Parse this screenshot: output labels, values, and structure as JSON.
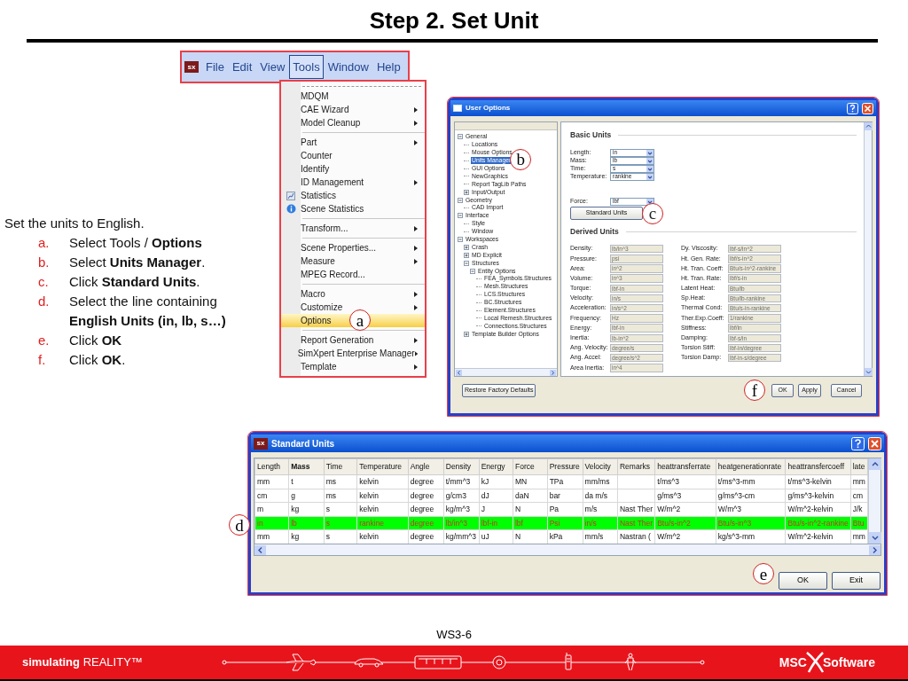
{
  "title": "Step 2. Set Unit",
  "instructions": {
    "intro": "Set the units to English.",
    "steps": [
      {
        "marker": "a.",
        "text": "Select Tools / **Options**"
      },
      {
        "marker": "b.",
        "text": "Select **Units Manager**."
      },
      {
        "marker": "c.",
        "text": "Click **Standard Units**."
      },
      {
        "marker": "d.",
        "text": "Select the line containing **English Units (in, lb, s…)**"
      },
      {
        "marker": "e.",
        "text": "Click **OK**"
      },
      {
        "marker": "f.",
        "text": "Click **OK**."
      }
    ]
  },
  "menu_bar": {
    "logo": "sx",
    "items": [
      {
        "label": "File",
        "selected": false
      },
      {
        "label": "Edit",
        "selected": false
      },
      {
        "label": "View",
        "selected": false
      },
      {
        "label": "Tools",
        "selected": true
      },
      {
        "label": "Window",
        "selected": false
      },
      {
        "label": "Help",
        "selected": false
      }
    ]
  },
  "tools_menu": {
    "groups": [
      {
        "items": [
          {
            "label": "MDQM",
            "kind": "plain",
            "submenu": false,
            "selected": false
          },
          {
            "label": "CAE Wizard",
            "kind": "plain",
            "submenu": true,
            "selected": false
          },
          {
            "label": "Model Cleanup",
            "kind": "plain",
            "submenu": true,
            "selected": false
          }
        ]
      },
      {
        "items": [
          {
            "label": "Part",
            "kind": "plain",
            "submenu": true,
            "selected": false
          },
          {
            "label": "Counter",
            "kind": "plain",
            "submenu": false,
            "selected": false
          },
          {
            "label": "Identify",
            "kind": "plain",
            "submenu": false,
            "selected": false
          },
          {
            "label": "ID Management",
            "kind": "plain",
            "submenu": true,
            "selected": false
          },
          {
            "label": "Statistics",
            "kind": "chart",
            "submenu": false,
            "selected": false
          },
          {
            "label": "Scene Statistics",
            "kind": "info",
            "submenu": false,
            "selected": false
          }
        ]
      },
      {
        "items": [
          {
            "label": "Transform...",
            "kind": "plain",
            "submenu": true,
            "selected": false
          }
        ]
      },
      {
        "items": [
          {
            "label": "Scene Properties...",
            "kind": "plain",
            "submenu": true,
            "selected": false
          },
          {
            "label": "Measure",
            "kind": "plain",
            "submenu": true,
            "selected": false
          },
          {
            "label": "MPEG Record...",
            "kind": "plain",
            "submenu": false,
            "selected": false
          }
        ]
      },
      {
        "items": [
          {
            "label": "Macro",
            "kind": "plain",
            "submenu": true,
            "selected": false
          },
          {
            "label": "Customize",
            "kind": "plain",
            "submenu": true,
            "selected": false
          },
          {
            "label": "Options",
            "kind": "plain",
            "submenu": false,
            "selected": true,
            "callout": "a"
          }
        ]
      },
      {
        "items": [
          {
            "label": "Report Generation",
            "kind": "plain",
            "submenu": true,
            "selected": false
          },
          {
            "label": "SimXpert Enterprise Manager",
            "kind": "plain",
            "submenu": true,
            "selected": false
          },
          {
            "label": "Template",
            "kind": "plain",
            "submenu": true,
            "selected": false
          }
        ]
      }
    ]
  },
  "user_options": {
    "title": "User Options",
    "tree": [
      {
        "label": "General",
        "expanded": true,
        "selected": false,
        "children": [
          {
            "label": "Locations",
            "selected": false
          },
          {
            "label": "Mouse Options",
            "selected": false
          },
          {
            "label": "Units Manager",
            "selected": true,
            "callout": "b"
          },
          {
            "label": "GUI Options",
            "selected": false
          },
          {
            "label": "NewGraphics",
            "selected": false
          },
          {
            "label": "Report TagLib Paths",
            "selected": false
          },
          {
            "label": "Input/Output",
            "expanded": false,
            "selected": false
          }
        ]
      },
      {
        "label": "Geometry",
        "expanded": true,
        "selected": false,
        "children": [
          {
            "label": "CAD Import",
            "selected": false
          }
        ]
      },
      {
        "label": "Interface",
        "expanded": true,
        "selected": false,
        "children": [
          {
            "label": "Style",
            "selected": false
          },
          {
            "label": "Window",
            "selected": false
          }
        ]
      },
      {
        "label": "Workspaces",
        "expanded": true,
        "selected": false,
        "children": [
          {
            "label": "Crash",
            "expanded": false,
            "selected": false
          },
          {
            "label": "MD Explicit",
            "expanded": false,
            "selected": false
          },
          {
            "label": "Structures",
            "expanded": true,
            "selected": false,
            "children": [
              {
                "label": "Entity Options",
                "expanded": true,
                "selected": false,
                "children": [
                  {
                    "label": "FEA_Symbols.Structures",
                    "selected": false
                  },
                  {
                    "label": "Mesh.Structures",
                    "selected": false
                  },
                  {
                    "label": "LCS.Structures",
                    "selected": false
                  },
                  {
                    "label": "BC.Structures",
                    "selected": false
                  },
                  {
                    "label": "Element.Structures",
                    "selected": false
                  },
                  {
                    "label": "Local Remesh.Structures",
                    "selected": false
                  },
                  {
                    "label": "Connections.Structures",
                    "selected": false
                  }
                ]
              }
            ]
          },
          {
            "label": "Template Builder Options",
            "expanded": false,
            "selected": false
          }
        ]
      }
    ],
    "basic_units": {
      "heading": "Basic Units",
      "fields": [
        {
          "label": "Length:",
          "value": "in"
        },
        {
          "label": "Mass:",
          "value": "lb"
        },
        {
          "label": "Time:",
          "value": "s"
        },
        {
          "label": "Temperature:",
          "value": "rankine"
        }
      ],
      "force": {
        "label": "Force:",
        "value": "lbf"
      },
      "button": {
        "label": "Standard Units",
        "callout": "c"
      }
    },
    "derived_units": {
      "heading": "Derived Units",
      "left": [
        {
          "label": "Density:",
          "value": "lb/in^3"
        },
        {
          "label": "Pressure:",
          "value": "psi"
        },
        {
          "label": "Area:",
          "value": "in^2"
        },
        {
          "label": "Volume:",
          "value": "in^3"
        },
        {
          "label": "Torque:",
          "value": "lbf-in"
        },
        {
          "label": "Velocity:",
          "value": "in/s"
        },
        {
          "label": "Acceleration:",
          "value": "in/s^2"
        },
        {
          "label": "Frequency:",
          "value": "Hz"
        },
        {
          "label": "Energy:",
          "value": "lbf-in"
        },
        {
          "label": "Inertia:",
          "value": "lb-in^2"
        },
        {
          "label": "Ang. Velocity:",
          "value": "degree/s"
        },
        {
          "label": "Ang. Accel:",
          "value": "degree/s^2"
        },
        {
          "label": "Area Inertia:",
          "value": "in^4"
        }
      ],
      "right": [
        {
          "label": "Dy. Viscosity:",
          "value": "lbf-s/in^2"
        },
        {
          "label": "Ht. Gen. Rate:",
          "value": "lbf/s-in^2"
        },
        {
          "label": "Ht. Tran. Coeff:",
          "value": "Btu/s-in^2-rankine"
        },
        {
          "label": "Ht. Tran. Rate:",
          "value": "lbf/s-in"
        },
        {
          "label": "Latent Heat:",
          "value": "Btu/lb"
        },
        {
          "label": "Sp.Heat:",
          "value": "Btu/lb-rankine"
        },
        {
          "label": "Thermal Cond:",
          "value": "Btu/s-in-rankine"
        },
        {
          "label": "Ther.Exp.Coeff:",
          "value": "1/rankine"
        },
        {
          "label": "Stiffness:",
          "value": "lbf/in"
        },
        {
          "label": "Damping:",
          "value": "lbf-s/in"
        },
        {
          "label": "Torsion Stiff:",
          "value": "lbf-in/degree"
        },
        {
          "label": "Torsion Damp:",
          "value": "lbf-in-s/degree"
        }
      ]
    },
    "restore_button": "Restore Factory Defaults",
    "buttons": [
      {
        "label": "OK",
        "callout": "f"
      },
      {
        "label": "Apply"
      },
      {
        "label": "Cancel"
      }
    ]
  },
  "standard_units": {
    "logo": "sx",
    "title": "Standard Units",
    "columns": [
      {
        "label": "Length",
        "sorted": false
      },
      {
        "label": "Mass",
        "sorted": true
      },
      {
        "label": "Time",
        "sorted": false
      },
      {
        "label": "Temperature",
        "sorted": false
      },
      {
        "label": "Angle",
        "sorted": false
      },
      {
        "label": "Density",
        "sorted": false
      },
      {
        "label": "Energy",
        "sorted": false
      },
      {
        "label": "Force",
        "sorted": false
      },
      {
        "label": "Pressure",
        "sorted": false
      },
      {
        "label": "Velocity",
        "sorted": false
      },
      {
        "label": "Remarks",
        "sorted": false
      },
      {
        "label": "heattransferrate",
        "sorted": false
      },
      {
        "label": "heatgenerationrate",
        "sorted": false
      },
      {
        "label": "heattransfercoeff",
        "sorted": false
      },
      {
        "label": "late",
        "sorted": false
      }
    ],
    "rows": [
      {
        "selected": false,
        "cells": [
          "mm",
          "t",
          "ms",
          "kelvin",
          "degree",
          "t/mm^3",
          "kJ",
          "MN",
          "TPa",
          "mm/ms",
          null,
          "t/ms^3",
          "t/ms^3-mm",
          "t/ms^3-kelvin",
          "mm"
        ]
      },
      {
        "selected": false,
        "cells": [
          "cm",
          "g",
          "ms",
          "kelvin",
          "degree",
          "g/cm3",
          "dJ",
          "daN",
          "bar",
          "da m/s",
          null,
          "g/ms^3",
          "g/ms^3-cm",
          "g/ms^3-kelvin",
          "cm"
        ]
      },
      {
        "selected": false,
        "cells": [
          "m",
          "kg",
          "s",
          "kelvin",
          "degree",
          "kg/m^3",
          "J",
          "N",
          "Pa",
          "m/s",
          "Nast Ther",
          "W/m^2",
          "W/m^3",
          "W/m^2-kelvin",
          "J/k"
        ]
      },
      {
        "selected": true,
        "callout": "d",
        "cells": [
          "in",
          "lb",
          "s",
          "rankine",
          "degree",
          "lb/in^3",
          "lbf-in",
          "lbf",
          "Psi",
          "in/s",
          "Nast Ther",
          "Btu/s-in^2",
          "Btu/s-in^3",
          "Btu/s-in^2-rankine",
          "Btu"
        ]
      },
      {
        "selected": false,
        "cells": [
          "mm",
          "kg",
          "s",
          "kelvin",
          "degree",
          "kg/mm^3",
          "uJ",
          "N",
          "kPa",
          "mm/s",
          "Nastran (",
          "W/m^2",
          "kg/s^3-mm",
          "W/m^2-kelvin",
          "mm"
        ]
      }
    ],
    "buttons": [
      {
        "label": "OK",
        "callout": "e"
      },
      {
        "label": "Exit"
      }
    ]
  },
  "footer": {
    "page": "WS3-6",
    "tagline": "**simulating** REALITY™",
    "logo_left": "MSC",
    "logo_right": "Software"
  }
}
